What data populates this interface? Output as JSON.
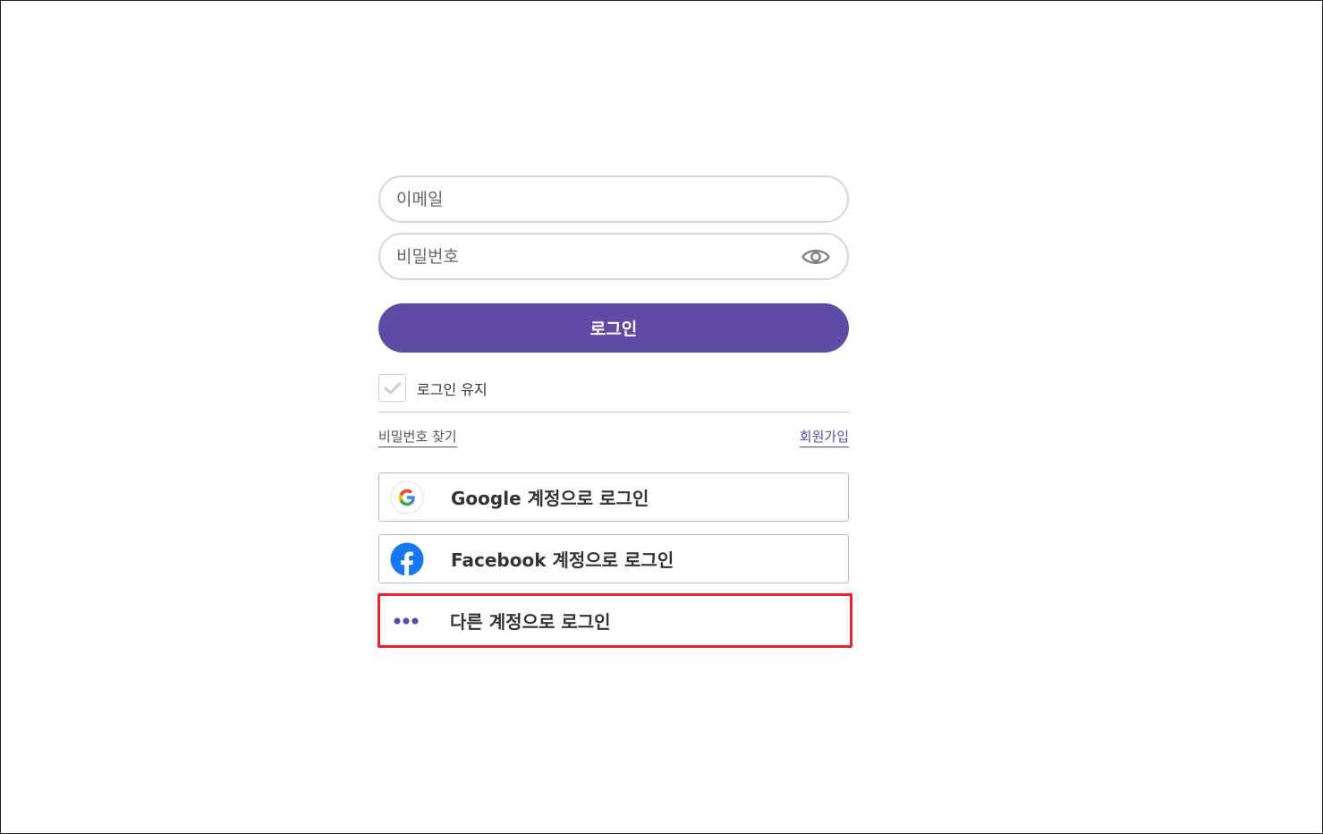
{
  "login_form": {
    "email_placeholder": "이메일",
    "password_placeholder": "비밀번호",
    "password_toggle_icon": "eye-icon",
    "login_button_label": "로그인",
    "keep_login_label": "로그인 유지",
    "keep_login_checked": false,
    "find_password_link": "비밀번호 찾기",
    "signup_link": "회원가입",
    "accent_color": "#5e4ba6"
  },
  "social_logins": {
    "google": {
      "label": "Google 계정으로 로그인",
      "icon": "google-icon"
    },
    "facebook": {
      "label": "Facebook 계정으로 로그인",
      "icon": "facebook-icon",
      "color": "#1877f2"
    },
    "other": {
      "label": "다른 계정으로 로그인",
      "icon": "more-dots-icon",
      "highlight_color": "#e8252a"
    }
  }
}
